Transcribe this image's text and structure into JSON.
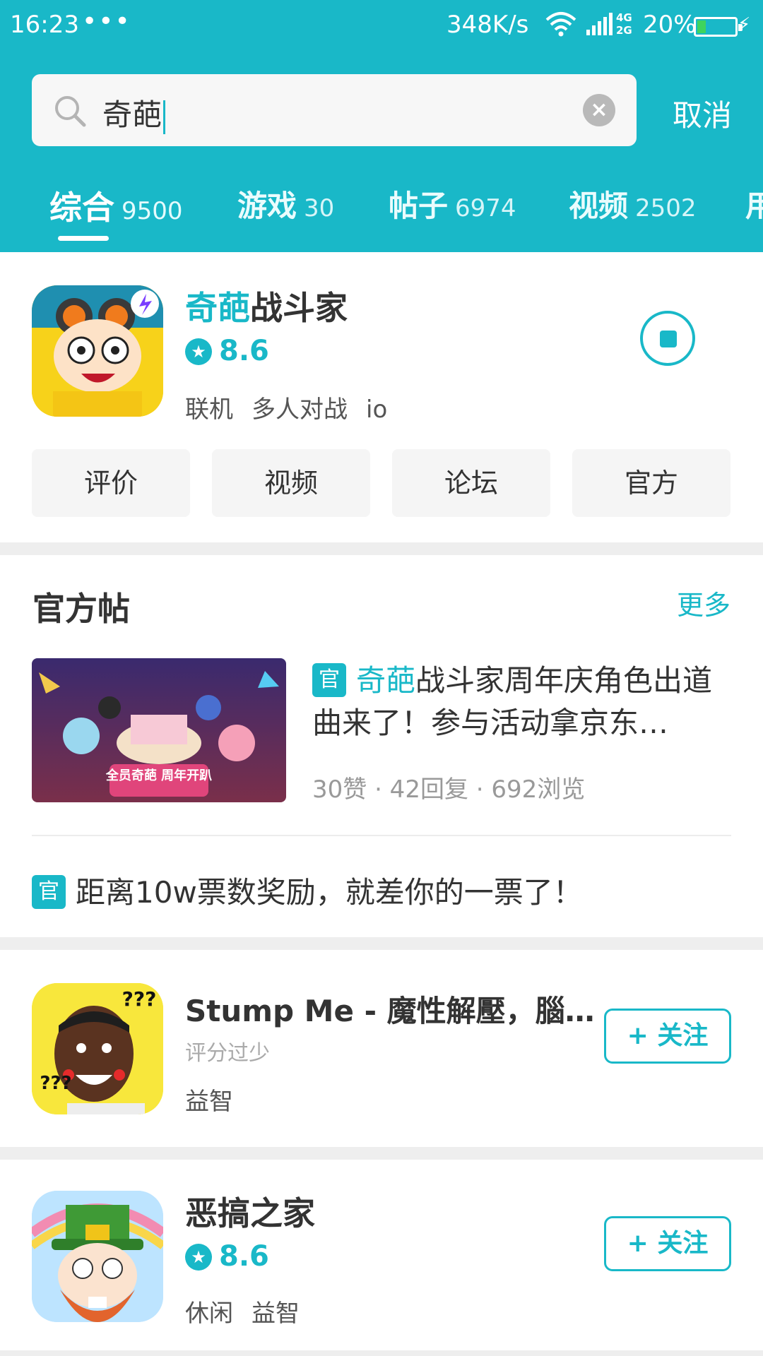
{
  "status_bar": {
    "time": "16:23",
    "dots": "•••",
    "speed": "348K/s",
    "network_top": "4G",
    "network_bottom": "2G",
    "battery": "20%",
    "battery_color": "#3ed45e"
  },
  "theme": {
    "accent": "#19b8c8"
  },
  "search": {
    "value": "奇葩",
    "clear_icon": "×",
    "cancel_label": "取消"
  },
  "tabs": [
    {
      "label": "综合",
      "count": "9500"
    },
    {
      "label": "游戏",
      "count": "30"
    },
    {
      "label": "帖子",
      "count": "6974"
    },
    {
      "label": "视频",
      "count": "2502"
    },
    {
      "label": "用",
      "count": ""
    }
  ],
  "top_game": {
    "title_highlight": "奇葩",
    "title_rest": "战斗家",
    "rating": "8.6",
    "tags": [
      "联机",
      "多人对战",
      "io"
    ],
    "quick_buttons": [
      "评价",
      "视频",
      "论坛",
      "官方"
    ]
  },
  "official_posts": {
    "title": "官方帖",
    "more": "更多",
    "badge": "官",
    "post": {
      "title_highlight": "奇葩",
      "title_rest": "战斗家周年庆角色出道曲来了！参与活动拿京东…",
      "image_text": "全员奇葩 周年开趴",
      "meta": "30赞 · 42回复 · 692浏览"
    },
    "announcement": "距离10w票数奖励，就差你的一票了！"
  },
  "games": [
    {
      "title": "Stump Me - 魔性解壓，腦…",
      "rating_note": "评分过少",
      "tags": [
        "益智"
      ],
      "follow_label": "+ 关注",
      "icon_text": "???"
    },
    {
      "title": "恶搞之家",
      "rating": "8.6",
      "tags": [
        "休闲",
        "益智"
      ],
      "follow_label": "+ 关注"
    }
  ]
}
